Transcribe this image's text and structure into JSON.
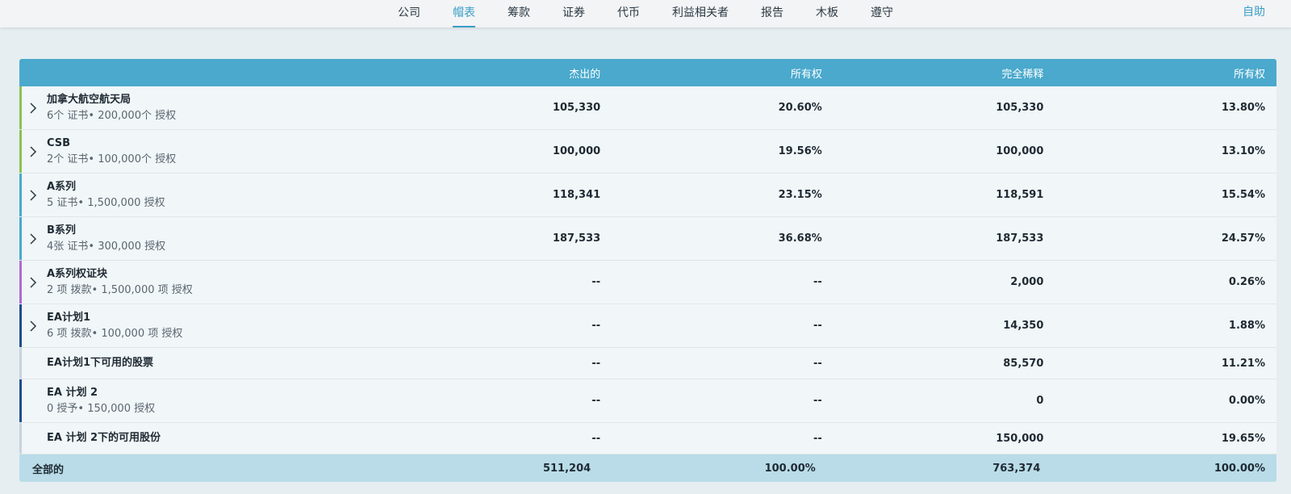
{
  "nav": {
    "items": [
      {
        "label": "公司",
        "active": false
      },
      {
        "label": "帽表",
        "active": true
      },
      {
        "label": "筹款",
        "active": false
      },
      {
        "label": "证券",
        "active": false
      },
      {
        "label": "代币",
        "active": false
      },
      {
        "label": "利益相关者",
        "active": false
      },
      {
        "label": "报告",
        "active": false
      },
      {
        "label": "木板",
        "active": false
      },
      {
        "label": "遵守",
        "active": false
      }
    ],
    "help": "自助"
  },
  "table": {
    "headers": [
      "杰出的",
      "所有权",
      "完全稀释",
      "所有权"
    ],
    "rows": [
      {
        "name": "加拿大航空航天局",
        "sub": "6个 证书• 200,000个 授权",
        "outstanding": "105,330",
        "ownership": "20.60%",
        "diluted": "105,330",
        "diluted_ownership": "13.80%",
        "color": "#8cc152",
        "expandable": true
      },
      {
        "name": "CSB",
        "sub": "2个 证书• 100,000个 授权",
        "outstanding": "100,000",
        "ownership": "19.56%",
        "diluted": "100,000",
        "diluted_ownership": "13.10%",
        "color": "#8cc152",
        "expandable": true
      },
      {
        "name": "A系列",
        "sub": "5 证书• 1,500,000 授权",
        "outstanding": "118,341",
        "ownership": "23.15%",
        "diluted": "118,591",
        "diluted_ownership": "15.54%",
        "color": "#4aa9cc",
        "expandable": true
      },
      {
        "name": "B系列",
        "sub": "4张 证书• 300,000 授权",
        "outstanding": "187,533",
        "ownership": "36.68%",
        "diluted": "187,533",
        "diluted_ownership": "24.57%",
        "color": "#4aa9cc",
        "expandable": true
      },
      {
        "name": "A系列权证块",
        "sub": "2 项 拨款• 1,500,000 项 授权",
        "outstanding": "--",
        "ownership": "--",
        "diluted": "2,000",
        "diluted_ownership": "0.26%",
        "color": "#b06ad0",
        "expandable": true
      },
      {
        "name": "EA计划1",
        "sub": "6 项 拨款• 100,000 项 授权",
        "outstanding": "--",
        "ownership": "--",
        "diluted": "14,350",
        "diluted_ownership": "1.88%",
        "color": "#1f4e8c",
        "expandable": true
      },
      {
        "name": "EA计划1下可用的股票",
        "sub": "",
        "outstanding": "--",
        "ownership": "--",
        "diluted": "85,570",
        "diluted_ownership": "11.21%",
        "color": "#c8d5dc",
        "expandable": false
      },
      {
        "name": "EA 计划 2",
        "sub": "0 授予• 150,000 授权",
        "outstanding": "--",
        "ownership": "--",
        "diluted": "0",
        "diluted_ownership": "0.00%",
        "color": "#1f4e8c",
        "expandable": false
      },
      {
        "name": "EA 计划 2下的可用股份",
        "sub": "",
        "outstanding": "--",
        "ownership": "--",
        "diluted": "150,000",
        "diluted_ownership": "19.65%",
        "color": "#c8d5dc",
        "expandable": false
      }
    ],
    "total": {
      "label": "全部的",
      "outstanding": "511,204",
      "ownership": "100.00%",
      "diluted": "763,374",
      "diluted_ownership": "100.00%"
    }
  }
}
